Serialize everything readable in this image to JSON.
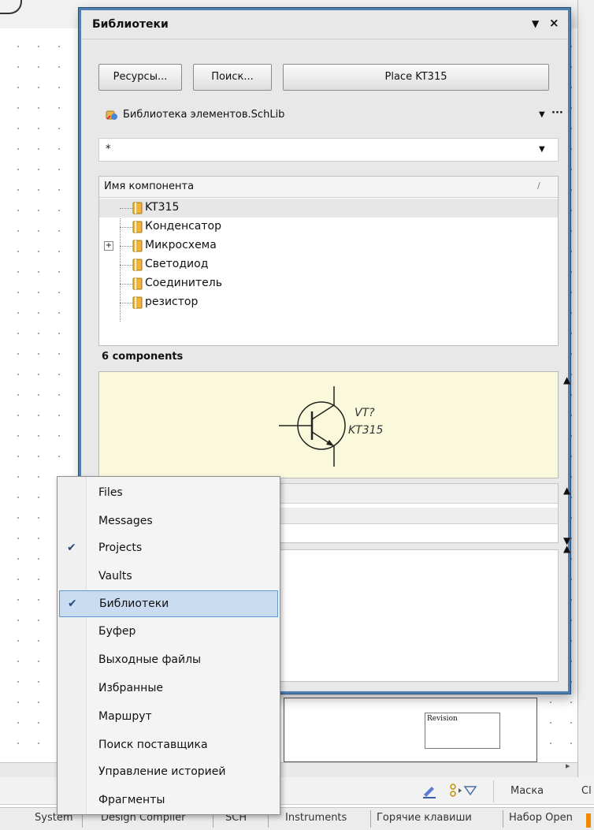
{
  "panel": {
    "title": "Библиотеки",
    "title_menu_glyph": "▼",
    "title_close_glyph": "×",
    "buttons": {
      "resources": "Ресурсы...",
      "search": "Поиск...",
      "place": "Place KT315"
    },
    "library_select": {
      "value": "Библиотека элементов.SchLib",
      "arrow": "▼",
      "more": "···"
    },
    "filter_select": {
      "value": "*",
      "arrow": "▼"
    },
    "components_list": {
      "header": "Имя компонента",
      "sort_glyph": "/",
      "items": [
        {
          "label": "KT315",
          "selected": true,
          "expandable": false
        },
        {
          "label": "Конденсатор",
          "selected": false,
          "expandable": false
        },
        {
          "label": "Микросхема",
          "selected": false,
          "expandable": true
        },
        {
          "label": "Светодиод",
          "selected": false,
          "expandable": false
        },
        {
          "label": "Соединитель",
          "selected": false,
          "expandable": false
        },
        {
          "label": "резистор",
          "selected": false,
          "expandable": false
        }
      ]
    },
    "count_text": "6 components",
    "preview": {
      "designator": "VT?",
      "comment": "KT315"
    }
  },
  "context_menu": {
    "items": [
      {
        "label": "Files",
        "checked": false,
        "highlighted": false
      },
      {
        "label": "Messages",
        "checked": false,
        "highlighted": false
      },
      {
        "label": "Projects",
        "checked": true,
        "highlighted": false
      },
      {
        "label": "Vaults",
        "checked": false,
        "highlighted": false
      },
      {
        "label": "Библиотеки",
        "checked": true,
        "highlighted": true
      },
      {
        "label": "Буфер",
        "checked": false,
        "highlighted": false
      },
      {
        "label": "Выходные файлы",
        "checked": false,
        "highlighted": false
      },
      {
        "label": "Избранные",
        "checked": false,
        "highlighted": false
      },
      {
        "label": "Маршрут",
        "checked": false,
        "highlighted": false
      },
      {
        "label": "Поиск поставщика",
        "checked": false,
        "highlighted": false
      },
      {
        "label": "Управление историей",
        "checked": false,
        "highlighted": false
      },
      {
        "label": "Фрагменты",
        "checked": false,
        "highlighted": false
      }
    ],
    "check_glyph": "✔"
  },
  "toolbar": {
    "mask_label": "Маска",
    "cut_label": "Cl"
  },
  "title_block": {
    "revision_label": "Revision"
  },
  "statusbar": {
    "items": [
      "System",
      "Design Compiler",
      "SCH",
      "Instruments",
      "Горячие клавиши",
      "Набор Open"
    ]
  },
  "colors": {
    "panel_border": "#4f7fb0",
    "preview_bg": "#fbf9dc",
    "menu_highlight": "#c9dcf1",
    "menu_highlight_border": "#5e98d4",
    "accent_orange": "#f08a00"
  }
}
